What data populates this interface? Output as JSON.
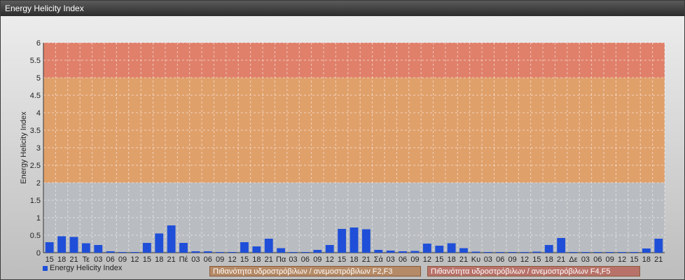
{
  "window": {
    "title": "Energy Helicity Index"
  },
  "chart_data": {
    "type": "bar",
    "ylabel": "Energy Helicity Index",
    "ylim": [
      0,
      6
    ],
    "y_ticks": [
      "0",
      "0.5",
      "1",
      "1.5",
      "2",
      "2.5",
      "3",
      "3.5",
      "4",
      "4.5",
      "5",
      "5.5",
      "6"
    ],
    "grid": true,
    "bands": [
      {
        "from": 0,
        "to": 2,
        "color": "#b9bcc0"
      },
      {
        "from": 2,
        "to": 5,
        "color": "#e0a06a",
        "legend": "Πιθανότητα υδροστρόβιλων / ανεμοστρόβιλων F2,F3"
      },
      {
        "from": 5,
        "to": 6,
        "color": "#e0806a",
        "legend": "Πιθανότητα υδροστρόβιλων / ανεμοστρόβιλων F4,F5"
      }
    ],
    "categories": [
      "15",
      "18",
      "21",
      "Τε",
      "03",
      "06",
      "09",
      "12",
      "15",
      "18",
      "21",
      "Πέ",
      "03",
      "06",
      "09",
      "12",
      "15",
      "18",
      "21",
      "Πα",
      "03",
      "06",
      "09",
      "12",
      "15",
      "18",
      "21",
      "Σά",
      "03",
      "06",
      "09",
      "12",
      "15",
      "18",
      "21",
      "Κυ",
      "03",
      "06",
      "09",
      "12",
      "15",
      "18",
      "21",
      "Δε",
      "03",
      "06",
      "09",
      "12",
      "15",
      "18",
      "21"
    ],
    "series": [
      {
        "name": "Energy Helicity Index",
        "color": "#1f4fd8",
        "values": [
          0.3,
          0.47,
          0.45,
          0.27,
          0.22,
          0.04,
          0.02,
          0.02,
          0.28,
          0.55,
          0.78,
          0.28,
          0.04,
          0.04,
          0.02,
          0.02,
          0.3,
          0.18,
          0.4,
          0.13,
          0.02,
          0.02,
          0.08,
          0.22,
          0.68,
          0.72,
          0.67,
          0.08,
          0.06,
          0.04,
          0.05,
          0.26,
          0.2,
          0.27,
          0.13,
          0.03,
          0.02,
          0.02,
          0.02,
          0.02,
          0.03,
          0.22,
          0.42,
          0.02,
          0.02,
          0.02,
          0.02,
          0.02,
          0.02,
          0.12,
          0.4
        ]
      }
    ]
  }
}
